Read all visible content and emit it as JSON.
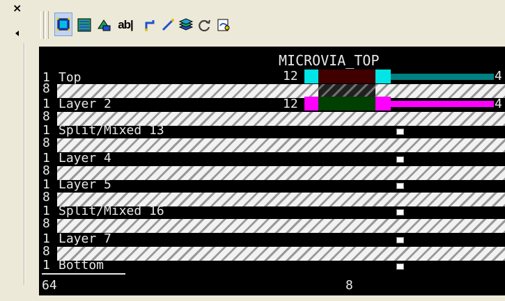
{
  "window": {
    "close_glyph": "×"
  },
  "toolbar": {
    "buttons": [
      {
        "icon": "board-outline-icon",
        "selected": true
      },
      {
        "icon": "layers-stack-icon",
        "selected": false
      },
      {
        "icon": "layer-component-icon",
        "selected": false
      },
      {
        "icon": "text-label-icon",
        "label": "ab|",
        "selected": false
      },
      {
        "icon": "route-trace-icon",
        "selected": false
      },
      {
        "icon": "diagonal-route-icon",
        "selected": false
      },
      {
        "icon": "stack-layers-icon",
        "selected": false
      },
      {
        "icon": "refresh-icon",
        "selected": false
      },
      {
        "icon": "copy-dialog-icon",
        "selected": false
      }
    ]
  },
  "view": {
    "title": "MICROVIA_TOP",
    "layers": [
      {
        "num": "1",
        "name": "Top",
        "val_left": "12",
        "val_right": "4"
      },
      {
        "num": "1",
        "name": "Layer 2",
        "val_left": "12",
        "val_right": "4"
      },
      {
        "num": "1",
        "name": "Split/Mixed 13"
      },
      {
        "num": "1",
        "name": "Layer 4"
      },
      {
        "num": "1",
        "name": "Layer 5"
      },
      {
        "num": "1",
        "name": "Split/Mixed 16"
      },
      {
        "num": "1",
        "name": "Layer 7"
      },
      {
        "num": "1",
        "name": "Bottom"
      }
    ],
    "dielectric_num": "8",
    "footer_left": "64",
    "footer_mid": "8",
    "colors": {
      "top_via": "#00e5e5",
      "top_line": "#008080",
      "top_block": "#400000",
      "l2_via": "#ff00ff",
      "l2_block": "#004000"
    }
  }
}
